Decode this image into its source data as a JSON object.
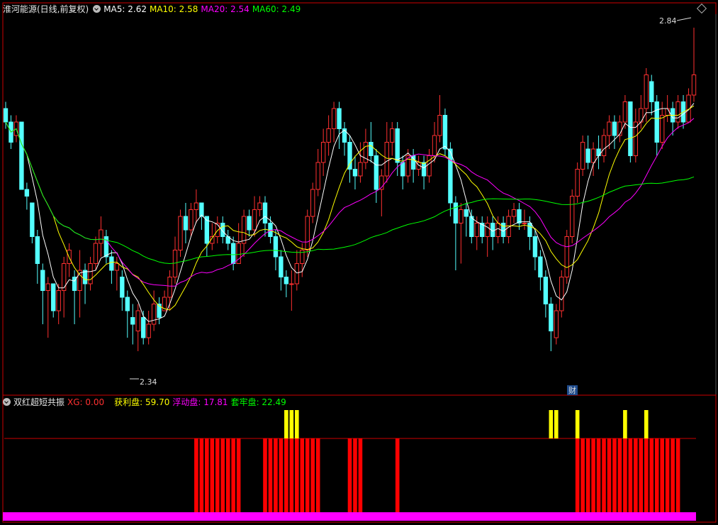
{
  "main_header": {
    "title": "淮河能源(日线,前复权)",
    "ma5": "MA5: 2.62",
    "ma10": "MA10: 2.58",
    "ma20": "MA20: 2.54",
    "ma60": "MA60: 2.49"
  },
  "sub_header": {
    "title": "双红超短共振",
    "xg": "XG: 0.00",
    "profit": "获利盘: 59.70",
    "float": "浮动盘: 17.81",
    "locked": "套牢盘: 22.49"
  },
  "colors": {
    "up": "#ff3030",
    "down": "#54ffff",
    "ma5": "#ffffff",
    "ma10": "#ffff00",
    "ma20": "#ff00ff",
    "ma60": "#00ff00",
    "bar_red": "#ff0000",
    "bar_yellow": "#ffff00",
    "baseline": "#ff00ff"
  },
  "chart_data": {
    "type": "candlestick",
    "ylim": [
      2.3,
      2.86
    ],
    "annotations": {
      "high_label": "2.84",
      "low_label": "2.34",
      "event_badge": "财"
    },
    "candles": [
      [
        2.72,
        2.7,
        2.73,
        2.69
      ],
      [
        2.7,
        2.67,
        2.71,
        2.66
      ],
      [
        2.68,
        2.7,
        2.71,
        2.67
      ],
      [
        2.7,
        2.6,
        2.7,
        2.6
      ],
      [
        2.6,
        2.59,
        2.61,
        2.57
      ],
      [
        2.58,
        2.53,
        2.58,
        2.52
      ],
      [
        2.53,
        2.49,
        2.54,
        2.46
      ],
      [
        2.48,
        2.45,
        2.49,
        2.4
      ],
      [
        2.45,
        2.46,
        2.47,
        2.38
      ],
      [
        2.46,
        2.42,
        2.46,
        2.41
      ],
      [
        2.42,
        2.45,
        2.46,
        2.4
      ],
      [
        2.45,
        2.49,
        2.5,
        2.41
      ],
      [
        2.49,
        2.51,
        2.52,
        2.47
      ],
      [
        2.47,
        2.45,
        2.48,
        2.4
      ],
      [
        2.45,
        2.48,
        2.51,
        2.41
      ],
      [
        2.48,
        2.46,
        2.49,
        2.43
      ],
      [
        2.46,
        2.49,
        2.5,
        2.45
      ],
      [
        2.49,
        2.52,
        2.53,
        2.48
      ],
      [
        2.52,
        2.54,
        2.56,
        2.5
      ],
      [
        2.53,
        2.5,
        2.54,
        2.49
      ],
      [
        2.5,
        2.48,
        2.51,
        2.46
      ],
      [
        2.48,
        2.49,
        2.5,
        2.45
      ],
      [
        2.47,
        2.44,
        2.48,
        2.42
      ],
      [
        2.44,
        2.42,
        2.45,
        2.38
      ],
      [
        2.41,
        2.4,
        2.43,
        2.37
      ],
      [
        2.39,
        2.42,
        2.43,
        2.36
      ],
      [
        2.41,
        2.38,
        2.42,
        2.37
      ],
      [
        2.38,
        2.4,
        2.42,
        2.37
      ],
      [
        2.4,
        2.43,
        2.45,
        2.39
      ],
      [
        2.43,
        2.41,
        2.44,
        2.4
      ],
      [
        2.42,
        2.44,
        2.45,
        2.42
      ],
      [
        2.44,
        2.47,
        2.48,
        2.42
      ],
      [
        2.47,
        2.51,
        2.53,
        2.46
      ],
      [
        2.51,
        2.56,
        2.57,
        2.5
      ],
      [
        2.56,
        2.54,
        2.58,
        2.52
      ],
      [
        2.54,
        2.57,
        2.58,
        2.53
      ],
      [
        2.57,
        2.58,
        2.6,
        2.55
      ],
      [
        2.58,
        2.56,
        2.58,
        2.54
      ],
      [
        2.56,
        2.52,
        2.56,
        2.5
      ],
      [
        2.52,
        2.53,
        2.55,
        2.51
      ],
      [
        2.53,
        2.55,
        2.56,
        2.52
      ],
      [
        2.55,
        2.53,
        2.56,
        2.52
      ],
      [
        2.53,
        2.52,
        2.54,
        2.51
      ],
      [
        2.52,
        2.49,
        2.53,
        2.48
      ],
      [
        2.49,
        2.52,
        2.55,
        2.49
      ],
      [
        2.52,
        2.56,
        2.57,
        2.5
      ],
      [
        2.56,
        2.54,
        2.57,
        2.53
      ],
      [
        2.54,
        2.57,
        2.59,
        2.53
      ],
      [
        2.57,
        2.58,
        2.59,
        2.56
      ],
      [
        2.58,
        2.55,
        2.59,
        2.53
      ],
      [
        2.55,
        2.53,
        2.56,
        2.52
      ],
      [
        2.53,
        2.5,
        2.54,
        2.48
      ],
      [
        2.5,
        2.47,
        2.51,
        2.45
      ],
      [
        2.47,
        2.46,
        2.48,
        2.44
      ],
      [
        2.46,
        2.46,
        2.48,
        2.42
      ],
      [
        2.46,
        2.49,
        2.51,
        2.45
      ],
      [
        2.49,
        2.51,
        2.52,
        2.47
      ],
      [
        2.51,
        2.56,
        2.57,
        2.5
      ],
      [
        2.56,
        2.6,
        2.61,
        2.55
      ],
      [
        2.6,
        2.64,
        2.66,
        2.59
      ],
      [
        2.64,
        2.67,
        2.69,
        2.62
      ],
      [
        2.67,
        2.69,
        2.71,
        2.65
      ],
      [
        2.69,
        2.72,
        2.73,
        2.67
      ],
      [
        2.72,
        2.69,
        2.73,
        2.66
      ],
      [
        2.69,
        2.67,
        2.7,
        2.65
      ],
      [
        2.67,
        2.63,
        2.68,
        2.61
      ],
      [
        2.63,
        2.62,
        2.65,
        2.6
      ],
      [
        2.62,
        2.64,
        2.67,
        2.61
      ],
      [
        2.64,
        2.67,
        2.69,
        2.63
      ],
      [
        2.67,
        2.65,
        2.7,
        2.64
      ],
      [
        2.65,
        2.6,
        2.66,
        2.58
      ],
      [
        2.6,
        2.62,
        2.63,
        2.56
      ],
      [
        2.62,
        2.67,
        2.7,
        2.61
      ],
      [
        2.67,
        2.69,
        2.7,
        2.65
      ],
      [
        2.69,
        2.64,
        2.7,
        2.62
      ],
      [
        2.64,
        2.62,
        2.65,
        2.6
      ],
      [
        2.62,
        2.65,
        2.66,
        2.61
      ],
      [
        2.65,
        2.63,
        2.66,
        2.61
      ],
      [
        2.63,
        2.64,
        2.65,
        2.62
      ],
      [
        2.64,
        2.62,
        2.65,
        2.6
      ],
      [
        2.62,
        2.65,
        2.66,
        2.61
      ],
      [
        2.65,
        2.68,
        2.7,
        2.64
      ],
      [
        2.68,
        2.71,
        2.74,
        2.67
      ],
      [
        2.71,
        2.66,
        2.72,
        2.65
      ],
      [
        2.66,
        2.58,
        2.67,
        2.56
      ],
      [
        2.58,
        2.55,
        2.59,
        2.48
      ],
      [
        2.55,
        2.57,
        2.58,
        2.49
      ],
      [
        2.57,
        2.56,
        2.58,
        2.53
      ],
      [
        2.56,
        2.53,
        2.57,
        2.52
      ],
      [
        2.53,
        2.55,
        2.56,
        2.51
      ],
      [
        2.55,
        2.53,
        2.56,
        2.52
      ],
      [
        2.53,
        2.55,
        2.56,
        2.5
      ],
      [
        2.55,
        2.53,
        2.56,
        2.51
      ],
      [
        2.53,
        2.55,
        2.56,
        2.52
      ],
      [
        2.55,
        2.53,
        2.56,
        2.52
      ],
      [
        2.53,
        2.56,
        2.57,
        2.52
      ],
      [
        2.56,
        2.57,
        2.58,
        2.55
      ],
      [
        2.57,
        2.55,
        2.58,
        2.54
      ],
      [
        2.55,
        2.55,
        2.57,
        2.54
      ],
      [
        2.55,
        2.53,
        2.56,
        2.51
      ],
      [
        2.53,
        2.5,
        2.54,
        2.48
      ],
      [
        2.5,
        2.47,
        2.51,
        2.45
      ],
      [
        2.47,
        2.43,
        2.48,
        2.41
      ],
      [
        2.43,
        2.39,
        2.44,
        2.36
      ],
      [
        2.38,
        2.42,
        2.43,
        2.37
      ],
      [
        2.42,
        2.47,
        2.48,
        2.41
      ],
      [
        2.47,
        2.53,
        2.54,
        2.46
      ],
      [
        2.53,
        2.59,
        2.6,
        2.52
      ],
      [
        2.59,
        2.63,
        2.64,
        2.58
      ],
      [
        2.63,
        2.67,
        2.68,
        2.62
      ],
      [
        2.66,
        2.64,
        2.68,
        2.63
      ],
      [
        2.64,
        2.66,
        2.67,
        2.62
      ],
      [
        2.66,
        2.65,
        2.68,
        2.63
      ],
      [
        2.65,
        2.68,
        2.69,
        2.64
      ],
      [
        2.68,
        2.7,
        2.71,
        2.66
      ],
      [
        2.7,
        2.68,
        2.71,
        2.66
      ],
      [
        2.68,
        2.7,
        2.71,
        2.67
      ],
      [
        2.7,
        2.73,
        2.74,
        2.69
      ],
      [
        2.73,
        2.65,
        2.73,
        2.64
      ],
      [
        2.65,
        2.7,
        2.72,
        2.64
      ],
      [
        2.7,
        2.72,
        2.74,
        2.69
      ],
      [
        2.72,
        2.77,
        2.78,
        2.7
      ],
      [
        2.76,
        2.73,
        2.77,
        2.71
      ],
      [
        2.73,
        2.67,
        2.74,
        2.65
      ],
      [
        2.67,
        2.71,
        2.73,
        2.66
      ],
      [
        2.71,
        2.72,
        2.74,
        2.7
      ],
      [
        2.72,
        2.7,
        2.73,
        2.68
      ],
      [
        2.7,
        2.73,
        2.74,
        2.69
      ],
      [
        2.73,
        2.7,
        2.74,
        2.69
      ],
      [
        2.7,
        2.74,
        2.75,
        2.7
      ],
      [
        2.74,
        2.77,
        2.84,
        2.73
      ]
    ],
    "signal_bars": {
      "red": [
        36,
        37,
        38,
        39,
        40,
        41,
        42,
        43,
        44,
        49,
        50,
        51,
        52,
        53,
        54,
        55,
        56,
        57,
        58,
        59,
        65,
        66,
        67,
        74,
        108,
        109,
        110,
        111,
        112,
        113,
        114,
        115,
        116,
        117,
        118,
        119,
        120,
        121,
        122,
        123,
        124,
        125,
        126,
        127
      ],
      "yellow": [
        53,
        54,
        55,
        103,
        104,
        108,
        117,
        121
      ]
    }
  }
}
